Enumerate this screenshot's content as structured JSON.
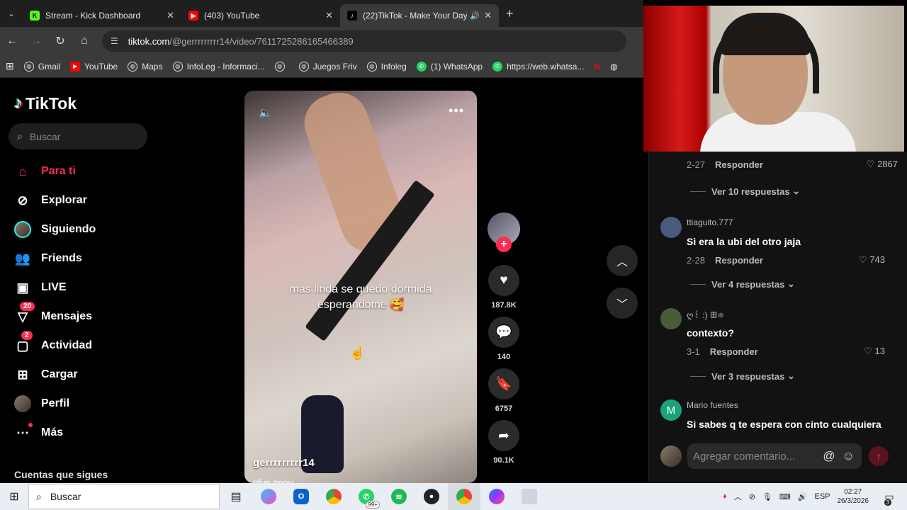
{
  "browser": {
    "tabs": [
      {
        "title": "Stream - Kick Dashboard",
        "favicon": "K",
        "favicon_color": "#53fc18",
        "active": false
      },
      {
        "title": "(403) YouTube",
        "favicon": "▶",
        "favicon_color": "#ff0000",
        "active": false
      },
      {
        "title": "(22)TikTok - Make Your Day",
        "favicon": "♪",
        "favicon_color": "#000000",
        "active": true
      }
    ],
    "url_domain": "tiktok.com",
    "url_path": "/@gerrrrrrrrr14/video/7611725286165466389",
    "bookmarks": [
      {
        "label": "Gmail",
        "icon": "globe-icon"
      },
      {
        "label": "YouTube",
        "icon": "youtube-icon"
      },
      {
        "label": "Maps",
        "icon": "globe-icon"
      },
      {
        "label": "InfoLeg - Informaci...",
        "icon": "globe-icon"
      },
      {
        "label": "",
        "icon": "globe-icon"
      },
      {
        "label": "Juegos Friv",
        "icon": "globe-icon"
      },
      {
        "label": "Infoleg",
        "icon": "globe-icon"
      },
      {
        "label": "(1) WhatsApp",
        "icon": "whatsapp-icon"
      },
      {
        "label": "https://web.whatsa...",
        "icon": "whatsapp-icon"
      }
    ]
  },
  "tiktok": {
    "logo": "TikTok",
    "search_placeholder": "Buscar",
    "menu": [
      {
        "label": "Para ti",
        "icon": "home-icon",
        "active": true,
        "badge": ""
      },
      {
        "label": "Explorar",
        "icon": "compass-icon",
        "active": false,
        "badge": ""
      },
      {
        "label": "Siguiendo",
        "icon": "avatar-icon",
        "active": false,
        "badge": ""
      },
      {
        "label": "Friends",
        "icon": "friends-icon",
        "active": false,
        "badge": ""
      },
      {
        "label": "LIVE",
        "icon": "live-icon",
        "active": false,
        "badge": ""
      },
      {
        "label": "Mensajes",
        "icon": "messages-icon",
        "active": false,
        "badge": "20"
      },
      {
        "label": "Actividad",
        "icon": "activity-icon",
        "active": false,
        "badge": "2"
      },
      {
        "label": "Cargar",
        "icon": "upload-icon",
        "active": false,
        "badge": ""
      },
      {
        "label": "Perfil",
        "icon": "profile-icon",
        "active": false,
        "badge": ""
      },
      {
        "label": "Más",
        "icon": "more-icon",
        "active": false,
        "badge": ""
      }
    ],
    "following_heading": "Cuentas que sigues",
    "video": {
      "caption_line1": "mas linda se quedo dormida",
      "caption_line2": "esperandome 🥰",
      "username": "gerrrrrrrrr14",
      "tags": "#fyp #pov"
    },
    "actions": {
      "likes": "187.8K",
      "comments": "140",
      "saves": "6757",
      "shares": "90.1K"
    },
    "comments": [
      {
        "type": "meta",
        "date": "2-27",
        "reply": "Responder",
        "likes": "2867"
      },
      {
        "type": "more",
        "label": "Ver 10 respuestas"
      },
      {
        "type": "comment",
        "user": "ttiaguito.777",
        "text": "Si era la ubi del otro jaja",
        "date": "2-28",
        "reply": "Responder",
        "likes": "743",
        "avatar_color": "#4a5a7a"
      },
      {
        "type": "more",
        "label": "Ver 4 respuestas"
      },
      {
        "type": "comment",
        "user": "ღ꒰ :) ꕥ❄",
        "text": "contexto?",
        "date": "3-1",
        "reply": "Responder",
        "likes": "13",
        "avatar_color": "#4a5a3a"
      },
      {
        "type": "more",
        "label": "Ver 3 respuestas"
      },
      {
        "type": "comment",
        "user": "Mario fuentes",
        "text": "Si sabes q te espera con cinto cualquiera",
        "date": "",
        "reply": "",
        "likes": "",
        "avatar_color": "#1aa37a",
        "initial": "M"
      }
    ],
    "add_comment_placeholder": "Agregar comentario..."
  },
  "taskbar": {
    "search": "Buscar",
    "language": "ESP",
    "time": "02:27",
    "date": "26/3/2026",
    "whatsapp_count": "99+",
    "notifications": "3"
  }
}
